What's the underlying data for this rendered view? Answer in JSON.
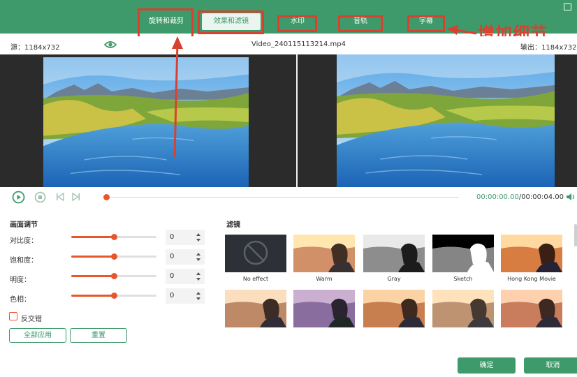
{
  "tabs": [
    {
      "label": "旋转和裁剪"
    },
    {
      "label": "效果和滤镜"
    },
    {
      "label": "水印"
    },
    {
      "label": "音轨"
    },
    {
      "label": "字幕"
    }
  ],
  "annotation": {
    "label": "增加细节",
    "color": "#d8412f"
  },
  "info": {
    "source_label": "源：1184x732",
    "filename": "Video_240115113214.mp4",
    "output_label": "输出：1184x732"
  },
  "playback": {
    "current_time": "00:00:00.00",
    "total_time": "/00:00:04.00",
    "progress": 0
  },
  "adjust": {
    "title": "画面调节",
    "items": [
      {
        "label": "对比度：",
        "value": "0",
        "level": 0.5
      },
      {
        "label": "饱和度：",
        "value": "0",
        "level": 0.5
      },
      {
        "label": "明度：",
        "value": "0",
        "level": 0.5
      },
      {
        "label": "色相：",
        "value": "0",
        "level": 0.5
      }
    ],
    "invert_label": "反交错",
    "apply_all_label": "全部应用",
    "reset_label": "重置"
  },
  "filters": {
    "title": "滤镜",
    "items": [
      {
        "label": "No effect"
      },
      {
        "label": "Warm"
      },
      {
        "label": "Gray"
      },
      {
        "label": "Sketch"
      },
      {
        "label": "Hong Kong Movie"
      },
      {
        "label": ""
      },
      {
        "label": ""
      },
      {
        "label": ""
      },
      {
        "label": ""
      },
      {
        "label": ""
      }
    ]
  },
  "footer": {
    "confirm_label": "确定",
    "cancel_label": "取消"
  },
  "colors": {
    "brand": "#3f9a6b",
    "accent": "#e8572b",
    "annotation": "#d8412f"
  }
}
